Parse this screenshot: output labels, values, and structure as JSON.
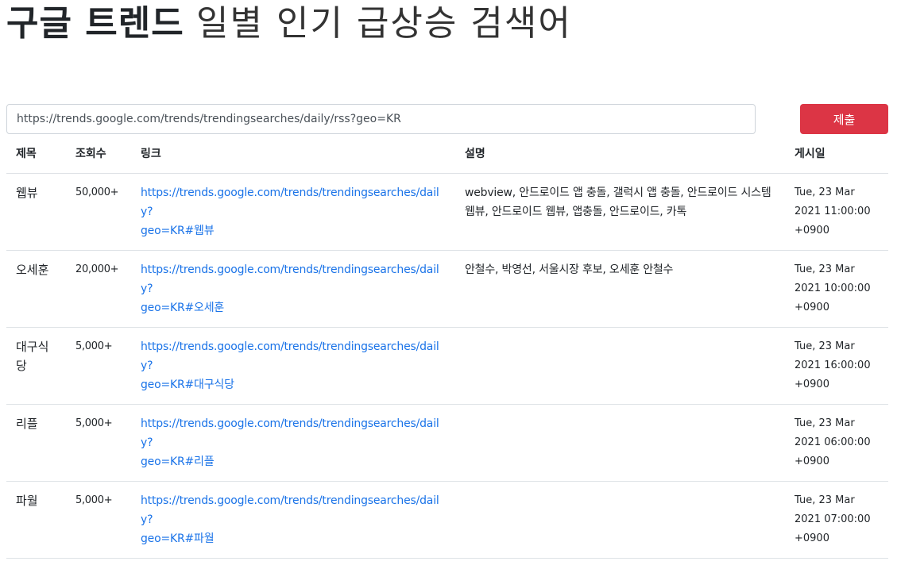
{
  "header": {
    "title_bold": "구글 트렌드",
    "title_light": "일별 인기 급상승 검색어"
  },
  "form": {
    "url_value": "https://trends.google.com/trends/trendingsearches/daily/rss?geo=KR",
    "submit_label": "제출"
  },
  "table": {
    "columns": [
      "제목",
      "조회수",
      "링크",
      "설명",
      "게시일"
    ],
    "rows": [
      {
        "title": "웹뷰",
        "views": "50,000+",
        "link_line1": "https://trends.google.com/trends/trendingsearches/daily?",
        "link_line2": "geo=KR#웹뷰",
        "description": "webview, 안드로이드 앱 충돌, 갤럭시 앱 충돌, 안드로이드 시스템 웹뷰, 안드로이드 웹뷰, 앱충돌, 안드로이드, 카톡",
        "date_line1": "Tue, 23 Mar",
        "date_line2": "2021 11:00:00",
        "date_line3": "+0900"
      },
      {
        "title": "오세훈",
        "views": "20,000+",
        "link_line1": "https://trends.google.com/trends/trendingsearches/daily?",
        "link_line2": "geo=KR#오세훈",
        "description": "안철수, 박영선, 서울시장 후보, 오세훈 안철수",
        "date_line1": "Tue, 23 Mar",
        "date_line2": "2021 10:00:00",
        "date_line3": "+0900"
      },
      {
        "title": "대구식당",
        "views": "5,000+",
        "link_line1": "https://trends.google.com/trends/trendingsearches/daily?",
        "link_line2": "geo=KR#대구식당",
        "description": "",
        "date_line1": "Tue, 23 Mar",
        "date_line2": "2021 16:00:00",
        "date_line3": "+0900"
      },
      {
        "title": "리플",
        "views": "5,000+",
        "link_line1": "https://trends.google.com/trends/trendingsearches/daily?",
        "link_line2": "geo=KR#리플",
        "description": "",
        "date_line1": "Tue, 23 Mar",
        "date_line2": "2021 06:00:00",
        "date_line3": "+0900"
      },
      {
        "title": "파월",
        "views": "5,000+",
        "link_line1": "https://trends.google.com/trends/trendingsearches/daily?",
        "link_line2": "geo=KR#파월",
        "description": "",
        "date_line1": "Tue, 23 Mar",
        "date_line2": "2021 07:00:00",
        "date_line3": "+0900"
      }
    ]
  },
  "colors": {
    "submit_bg": "#dc3545",
    "link": "#1a73e8",
    "border": "#dee2e6"
  }
}
